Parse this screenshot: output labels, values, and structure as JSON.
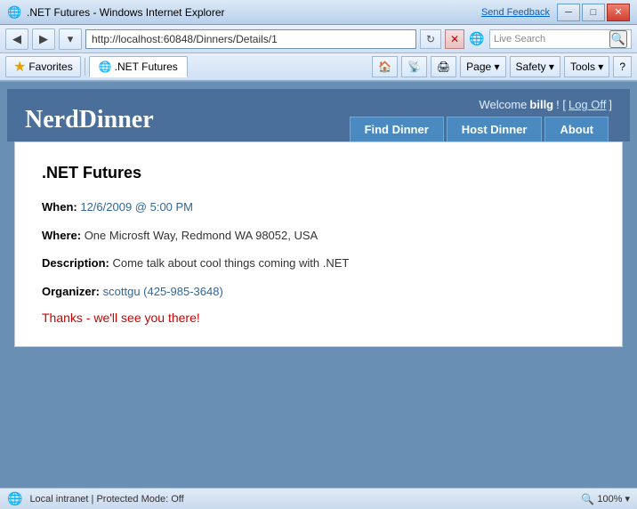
{
  "titleBar": {
    "icon": "🌐",
    "title": ".NET Futures - Windows Internet Explorer",
    "sendFeedback": "Send Feedback",
    "buttons": {
      "minimize": "─",
      "restore": "□",
      "close": "✕"
    }
  },
  "addressBar": {
    "backBtn": "◀",
    "forwardBtn": "▶",
    "url": "http://localhost:60848/Dinners/Details/1",
    "refreshIcon": "↻",
    "stopIcon": "✕",
    "ieLogo": "e",
    "liveSearch": "Live Search",
    "searchIcon": "🔍"
  },
  "toolbar": {
    "starIcon": "★",
    "favoritesLabel": "Favorites",
    "tabLabel": ".NET Futures",
    "pageLabel": "Page ▾",
    "safetyLabel": "Safety ▾",
    "toolsLabel": "Tools ▾",
    "helpIcon": "?"
  },
  "app": {
    "title": "NerdDinner",
    "welcome": "Welcome",
    "username": "billg",
    "welcomeSuffix": "! [",
    "logoff": "Log Off",
    "logoffSuffix": " ]",
    "nav": {
      "findDinner": "Find Dinner",
      "hostDinner": "Host Dinner",
      "about": "About"
    }
  },
  "dinner": {
    "title": ".NET Futures",
    "when": {
      "label": "When:",
      "value": "12/6/2009 @ 5:00 PM"
    },
    "where": {
      "label": "Where:",
      "value": "One Microsft Way, Redmond WA 98052, USA"
    },
    "description": {
      "label": "Description:",
      "value": "Come talk about cool things coming with .NET"
    },
    "organizer": {
      "label": "Organizer:",
      "value": "scottgu (425-985-3648)"
    },
    "thanks": "Thanks - we'll see you there!"
  },
  "statusBar": {
    "globeIcon": "🌐",
    "text": "Local intranet | Protected Mode: Off",
    "zoomIcon": "🔍",
    "zoom": "100%",
    "zoomArrow": "▾"
  }
}
